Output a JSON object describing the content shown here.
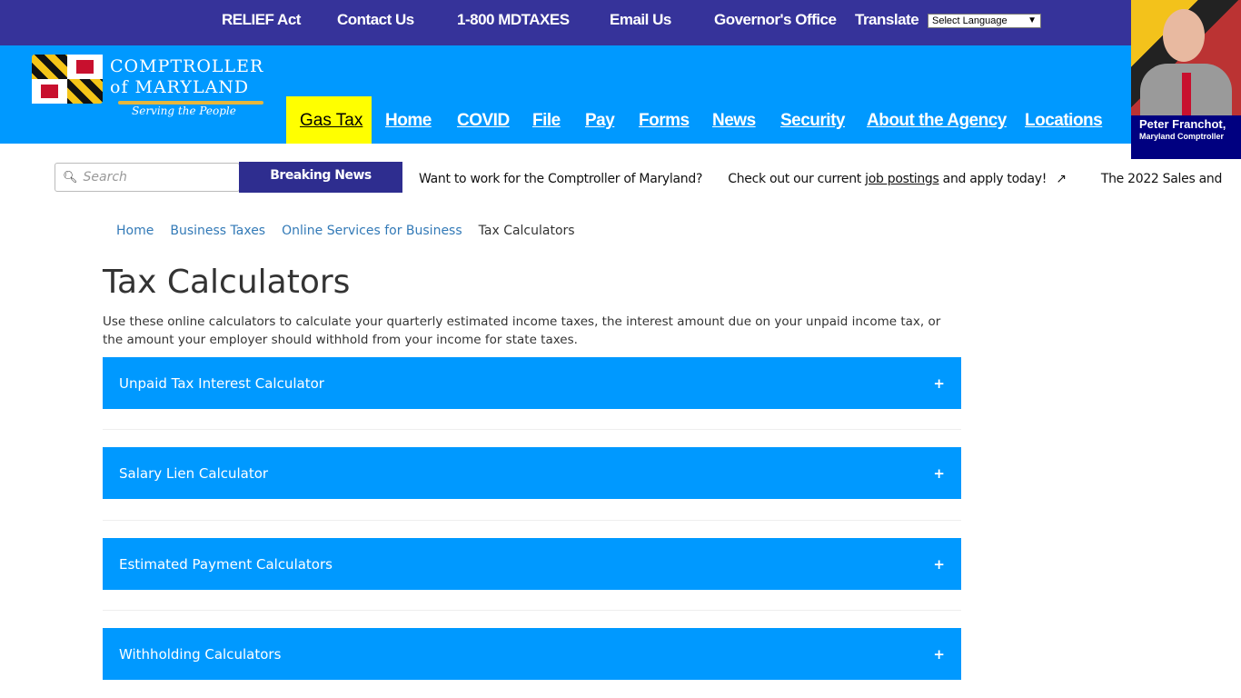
{
  "topbar": {
    "links": [
      "RELIEF Act",
      "Contact Us",
      "1-800 MDTAXES",
      "Email Us",
      "Governor's Office",
      "Translate"
    ],
    "language_select": "Select Language"
  },
  "logo": {
    "line1": "COMPTROLLER",
    "line2": "of MARYLAND",
    "tagline": "Serving the People"
  },
  "nav": {
    "highlight": "Gas Tax",
    "items": [
      "Home",
      "COVID",
      "File",
      "Pay",
      "Forms",
      "News",
      "Security",
      "About the Agency",
      "Locations"
    ],
    "highlight_color": "#ffff00"
  },
  "portrait": {
    "name": "Peter Franchot,",
    "role": "Maryland Comptroller"
  },
  "search": {
    "placeholder": "Search"
  },
  "breaking": {
    "label": "Breaking News",
    "item1": "Want to work for the Comptroller of Maryland?",
    "item2_pre": "Check out our current ",
    "item2_link": "job postings",
    "item2_post": " and apply today!",
    "item3": "The 2022 Sales and"
  },
  "breadcrumb": [
    "Home",
    "Business Taxes",
    "Online Services for Business",
    "Tax Calculators"
  ],
  "page": {
    "title": "Tax Calculators",
    "intro": "Use these online calculators to calculate your quarterly estimated income taxes, the interest amount due on your unpaid income tax, or the amount your employer should withhold from your income for state taxes."
  },
  "accordions": [
    "Unpaid Tax Interest Calculator",
    "Salary Lien Calculator",
    "Estimated Payment Calculators",
    "Withholding Calculators"
  ],
  "colors": {
    "topbar": "#36339a",
    "mainbar": "#0099ff",
    "accordion": "#0099ff"
  }
}
